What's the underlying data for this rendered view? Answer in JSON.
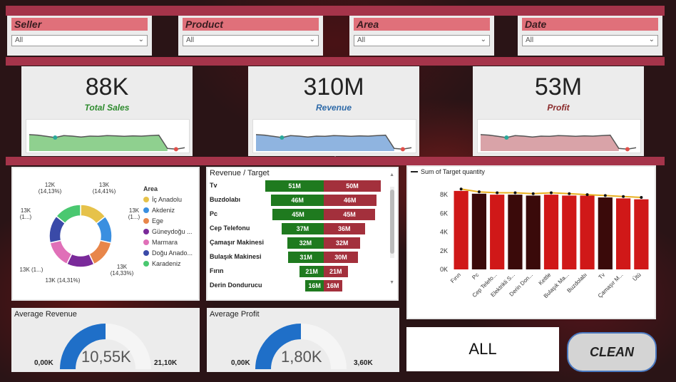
{
  "slicers": [
    {
      "label": "Seller",
      "value": "All"
    },
    {
      "label": "Product",
      "value": "All"
    },
    {
      "label": "Area",
      "value": "All"
    },
    {
      "label": "Date",
      "value": "All"
    }
  ],
  "kpis": [
    {
      "value": "88K",
      "label": "Total Sales",
      "label_color": "#2e8b2e",
      "fill": "#8fd08f",
      "stroke": "#555"
    },
    {
      "value": "310M",
      "label": "Revenue",
      "label_color": "#2e6aa8",
      "fill": "#8fb4e0",
      "stroke": "#555"
    },
    {
      "value": "53M",
      "label": "Profit",
      "label_color": "#8a2a2a",
      "fill": "#d9a3a8",
      "stroke": "#555"
    }
  ],
  "donut": {
    "legend_title": "Area",
    "slices": [
      {
        "name": "İç Anadolu",
        "value": 14.41,
        "color": "#e6c24a"
      },
      {
        "name": "Akdeniz",
        "value": 14.2,
        "color": "#3a8fe0"
      },
      {
        "name": "Ege",
        "value": 14.33,
        "color": "#e8864a"
      },
      {
        "name": "Güneydoğu ...",
        "value": 14.31,
        "color": "#7a2a9a"
      },
      {
        "name": "Marmara",
        "value": 14.2,
        "color": "#e070b8"
      },
      {
        "name": "Doğu Anado...",
        "value": 14.42,
        "color": "#3a4aa8"
      },
      {
        "name": "Karadeniz",
        "value": 14.13,
        "color": "#4ac870"
      }
    ],
    "labels": [
      {
        "top": "12K",
        "bottom": "(14,13%)"
      },
      {
        "top": "13K",
        "bottom": "(14,41%)"
      },
      {
        "top": "13K",
        "bottom": "(1...)"
      },
      {
        "top": "13K",
        "bottom": "(14,33%)"
      },
      {
        "top": "13K (14,31%)",
        "bottom": ""
      },
      {
        "top": "13K (1...)",
        "bottom": ""
      },
      {
        "top": "13K",
        "bottom": "(1...)"
      }
    ]
  },
  "revenue_target": {
    "title": "Revenue / Target",
    "rows": [
      {
        "name": "Tv",
        "revenue": "51M",
        "target": "50M",
        "rev": 51,
        "tgt": 50
      },
      {
        "name": "Buzdolabı",
        "revenue": "46M",
        "target": "46M",
        "rev": 46,
        "tgt": 46
      },
      {
        "name": "Pc",
        "revenue": "45M",
        "target": "45M",
        "rev": 45,
        "tgt": 45
      },
      {
        "name": "Cep Telefonu",
        "revenue": "37M",
        "target": "36M",
        "rev": 37,
        "tgt": 36
      },
      {
        "name": "Çamaşır Makinesi",
        "revenue": "32M",
        "target": "32M",
        "rev": 32,
        "tgt": 32
      },
      {
        "name": "Bulaşık Makinesi",
        "revenue": "31M",
        "target": "30M",
        "rev": 31,
        "tgt": 30
      },
      {
        "name": "Fırın",
        "revenue": "21M",
        "target": "21M",
        "rev": 21,
        "tgt": 21
      },
      {
        "name": "Derin Dondurucu",
        "revenue": "16M",
        "target": "16M",
        "rev": 16,
        "tgt": 16
      }
    ],
    "rev_color": "#1f7a1f",
    "tgt_color": "#a3303c"
  },
  "chart_data": {
    "type": "bar",
    "legend": "Sum of Target quantity",
    "categories": [
      "Fırın",
      "Pc",
      "Cep Telefo...",
      "Elektrikli S...",
      "Derin Don...",
      "Kettle",
      "Bulaşık Ma...",
      "Buzdolabı",
      "Tv",
      "Çamaşır M...",
      "Ütü"
    ],
    "values": [
      8.4,
      8.1,
      8.0,
      8.0,
      7.9,
      8.0,
      7.9,
      7.9,
      7.7,
      7.6,
      7.5
    ],
    "target": [
      8.6,
      8.3,
      8.2,
      8.2,
      8.1,
      8.2,
      8.1,
      8.0,
      7.9,
      7.8,
      7.7
    ],
    "bar_colors": [
      "#d01818",
      "#3a0a0a",
      "#d01818",
      "#3a0a0a",
      "#3a0a0a",
      "#d01818",
      "#d01818",
      "#d01818",
      "#3a0a0a",
      "#d01818",
      "#d01818"
    ],
    "ylim": [
      0,
      9
    ],
    "yticks": [
      "0K",
      "2K",
      "4K",
      "6K",
      "8K"
    ],
    "line_color": "#e8b020"
  },
  "gauges": [
    {
      "title": "Average Revenue",
      "value": "10,55K",
      "min": "0,00K",
      "max": "21,10K",
      "fraction": 0.5
    },
    {
      "title": "Average Profit",
      "value": "1,80K",
      "min": "0,00K",
      "max": "3,60K",
      "fraction": 0.5
    }
  ],
  "gauge_color": "#1f6fc8",
  "gauge_bg": "#f5f5f5",
  "all_label": "ALL",
  "clean_label": "CLEAN"
}
